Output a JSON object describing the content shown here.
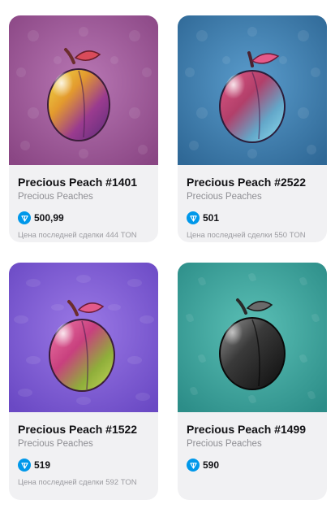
{
  "colors": {
    "ton_accent": "#0098ea",
    "card_background": "#f1f1f3"
  },
  "items": [
    {
      "title": "Precious Peach #1401",
      "collection": "Precious Peaches",
      "price": "500,99",
      "last_deal": "Цена последней сделки 444 TON",
      "background": "purple-pink",
      "peach": "golden-rainbow",
      "pattern": "apple-icons"
    },
    {
      "title": "Precious Peach #2522",
      "collection": "Precious Peaches",
      "price": "501",
      "last_deal": "Цена последней сделки 550 TON",
      "background": "steel-blue",
      "peach": "pink-cyan",
      "pattern": "apple-icons"
    },
    {
      "title": "Precious Peach #1522",
      "collection": "Precious Peaches",
      "price": "519",
      "last_deal": "Цена последней сделки 592 TON",
      "background": "violet",
      "peach": "pink-green",
      "pattern": "fish-icons"
    },
    {
      "title": "Precious Peach #1499",
      "collection": "Precious Peaches",
      "price": "590",
      "last_deal": "",
      "background": "teal",
      "peach": "black",
      "pattern": "leaf-icons"
    }
  ]
}
